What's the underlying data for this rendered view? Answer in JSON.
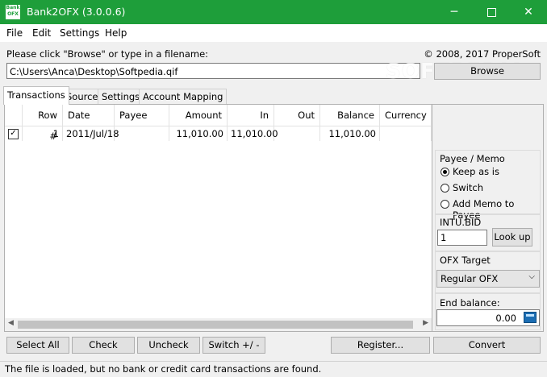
{
  "window": {
    "title": "Bank2OFX (3.0.0.6)",
    "icon_text_top": "Bank",
    "icon_text_bottom": "OFX"
  },
  "menu": [
    "File",
    "Edit",
    "Settings",
    "Help"
  ],
  "prompt_label": "Please click \"Browse\" or type in a filename:",
  "copyright": "© 2008, 2017 ProperSoft",
  "file_path": "C:\\Users\\Anca\\Desktop\\Softpedia.qif",
  "browse_label": "Browse",
  "watermark": "SOFTPEDIA",
  "tabs": [
    "Transactions",
    "Source",
    "Settings",
    "Account Mapping"
  ],
  "grid": {
    "columns": [
      "Row #",
      "Date",
      "Payee",
      "Amount",
      "In",
      "Out",
      "Balance",
      "Currency"
    ],
    "rows": [
      {
        "checked": true,
        "row": "1",
        "date": "2011/Jul/18",
        "payee": "",
        "amount": "11,010.00",
        "in": "11,010.00",
        "out": "",
        "balance": "11,010.00",
        "currency": ""
      }
    ]
  },
  "payee_memo": {
    "title": "Payee / Memo",
    "options": [
      "Keep as is",
      "Switch",
      "Add Memo to Payee"
    ],
    "selected": 0
  },
  "intu_bid": {
    "label": "INTU.BID",
    "value": "1",
    "lookup_label": "Look up"
  },
  "ofx_target": {
    "label": "OFX Target",
    "value": "Regular OFX"
  },
  "end_balance": {
    "label": "End balance:",
    "value": "0.00"
  },
  "buttons": {
    "select_all": "Select All",
    "check": "Check",
    "uncheck": "Uncheck",
    "switch": "Switch +/ -",
    "register": "Register...",
    "convert": "Convert"
  },
  "status": "The file is loaded, but no bank or credit card transactions are found."
}
